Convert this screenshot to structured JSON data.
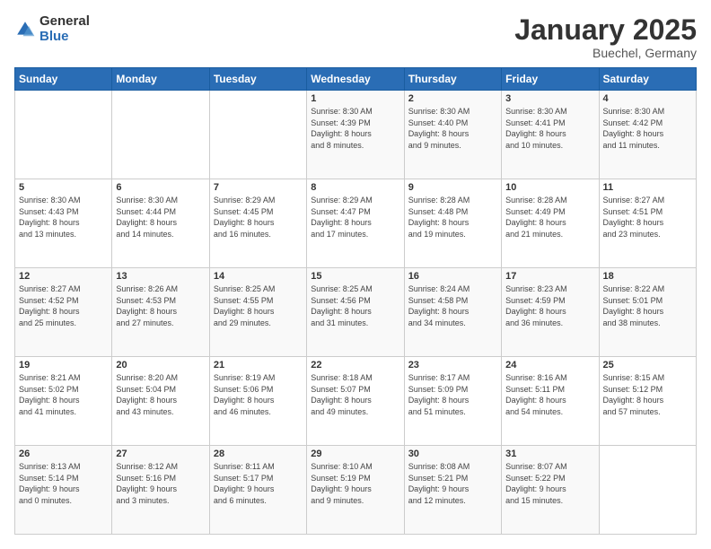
{
  "logo": {
    "general": "General",
    "blue": "Blue"
  },
  "header": {
    "month": "January 2025",
    "location": "Buechel, Germany"
  },
  "weekdays": [
    "Sunday",
    "Monday",
    "Tuesday",
    "Wednesday",
    "Thursday",
    "Friday",
    "Saturday"
  ],
  "weeks": [
    [
      {
        "day": "",
        "info": ""
      },
      {
        "day": "",
        "info": ""
      },
      {
        "day": "",
        "info": ""
      },
      {
        "day": "1",
        "info": "Sunrise: 8:30 AM\nSunset: 4:39 PM\nDaylight: 8 hours\nand 8 minutes."
      },
      {
        "day": "2",
        "info": "Sunrise: 8:30 AM\nSunset: 4:40 PM\nDaylight: 8 hours\nand 9 minutes."
      },
      {
        "day": "3",
        "info": "Sunrise: 8:30 AM\nSunset: 4:41 PM\nDaylight: 8 hours\nand 10 minutes."
      },
      {
        "day": "4",
        "info": "Sunrise: 8:30 AM\nSunset: 4:42 PM\nDaylight: 8 hours\nand 11 minutes."
      }
    ],
    [
      {
        "day": "5",
        "info": "Sunrise: 8:30 AM\nSunset: 4:43 PM\nDaylight: 8 hours\nand 13 minutes."
      },
      {
        "day": "6",
        "info": "Sunrise: 8:30 AM\nSunset: 4:44 PM\nDaylight: 8 hours\nand 14 minutes."
      },
      {
        "day": "7",
        "info": "Sunrise: 8:29 AM\nSunset: 4:45 PM\nDaylight: 8 hours\nand 16 minutes."
      },
      {
        "day": "8",
        "info": "Sunrise: 8:29 AM\nSunset: 4:47 PM\nDaylight: 8 hours\nand 17 minutes."
      },
      {
        "day": "9",
        "info": "Sunrise: 8:28 AM\nSunset: 4:48 PM\nDaylight: 8 hours\nand 19 minutes."
      },
      {
        "day": "10",
        "info": "Sunrise: 8:28 AM\nSunset: 4:49 PM\nDaylight: 8 hours\nand 21 minutes."
      },
      {
        "day": "11",
        "info": "Sunrise: 8:27 AM\nSunset: 4:51 PM\nDaylight: 8 hours\nand 23 minutes."
      }
    ],
    [
      {
        "day": "12",
        "info": "Sunrise: 8:27 AM\nSunset: 4:52 PM\nDaylight: 8 hours\nand 25 minutes."
      },
      {
        "day": "13",
        "info": "Sunrise: 8:26 AM\nSunset: 4:53 PM\nDaylight: 8 hours\nand 27 minutes."
      },
      {
        "day": "14",
        "info": "Sunrise: 8:25 AM\nSunset: 4:55 PM\nDaylight: 8 hours\nand 29 minutes."
      },
      {
        "day": "15",
        "info": "Sunrise: 8:25 AM\nSunset: 4:56 PM\nDaylight: 8 hours\nand 31 minutes."
      },
      {
        "day": "16",
        "info": "Sunrise: 8:24 AM\nSunset: 4:58 PM\nDaylight: 8 hours\nand 34 minutes."
      },
      {
        "day": "17",
        "info": "Sunrise: 8:23 AM\nSunset: 4:59 PM\nDaylight: 8 hours\nand 36 minutes."
      },
      {
        "day": "18",
        "info": "Sunrise: 8:22 AM\nSunset: 5:01 PM\nDaylight: 8 hours\nand 38 minutes."
      }
    ],
    [
      {
        "day": "19",
        "info": "Sunrise: 8:21 AM\nSunset: 5:02 PM\nDaylight: 8 hours\nand 41 minutes."
      },
      {
        "day": "20",
        "info": "Sunrise: 8:20 AM\nSunset: 5:04 PM\nDaylight: 8 hours\nand 43 minutes."
      },
      {
        "day": "21",
        "info": "Sunrise: 8:19 AM\nSunset: 5:06 PM\nDaylight: 8 hours\nand 46 minutes."
      },
      {
        "day": "22",
        "info": "Sunrise: 8:18 AM\nSunset: 5:07 PM\nDaylight: 8 hours\nand 49 minutes."
      },
      {
        "day": "23",
        "info": "Sunrise: 8:17 AM\nSunset: 5:09 PM\nDaylight: 8 hours\nand 51 minutes."
      },
      {
        "day": "24",
        "info": "Sunrise: 8:16 AM\nSunset: 5:11 PM\nDaylight: 8 hours\nand 54 minutes."
      },
      {
        "day": "25",
        "info": "Sunrise: 8:15 AM\nSunset: 5:12 PM\nDaylight: 8 hours\nand 57 minutes."
      }
    ],
    [
      {
        "day": "26",
        "info": "Sunrise: 8:13 AM\nSunset: 5:14 PM\nDaylight: 9 hours\nand 0 minutes."
      },
      {
        "day": "27",
        "info": "Sunrise: 8:12 AM\nSunset: 5:16 PM\nDaylight: 9 hours\nand 3 minutes."
      },
      {
        "day": "28",
        "info": "Sunrise: 8:11 AM\nSunset: 5:17 PM\nDaylight: 9 hours\nand 6 minutes."
      },
      {
        "day": "29",
        "info": "Sunrise: 8:10 AM\nSunset: 5:19 PM\nDaylight: 9 hours\nand 9 minutes."
      },
      {
        "day": "30",
        "info": "Sunrise: 8:08 AM\nSunset: 5:21 PM\nDaylight: 9 hours\nand 12 minutes."
      },
      {
        "day": "31",
        "info": "Sunrise: 8:07 AM\nSunset: 5:22 PM\nDaylight: 9 hours\nand 15 minutes."
      },
      {
        "day": "",
        "info": ""
      }
    ]
  ]
}
